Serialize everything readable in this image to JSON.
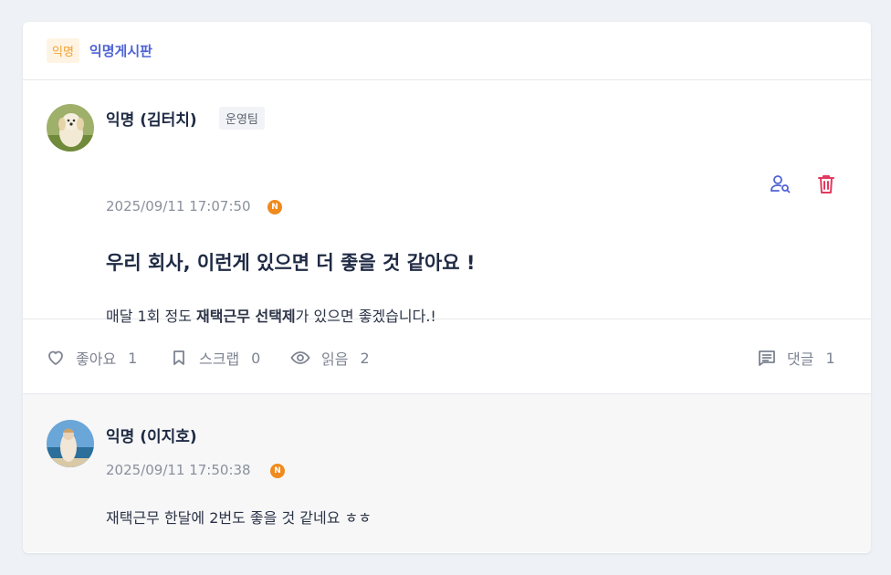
{
  "header": {
    "anon_badge": "익명",
    "board_name": "익명게시판"
  },
  "post": {
    "author": "익명 (김터치)",
    "team": "운영팀",
    "timestamp": "2025/09/11 17:07:50",
    "new_badge": "N",
    "title": "우리 회사, 이런게 있으면 더 좋을 것 같아요 !",
    "body_prefix": "매달 1회 정도 ",
    "body_bold": "재택근무 선택제",
    "body_suffix": "가 있으면 좋겠습니다.!"
  },
  "stats": {
    "like_label": "좋아요",
    "like_count": "1",
    "scrap_label": "스크랩",
    "scrap_count": "0",
    "read_label": "읽음",
    "read_count": "2",
    "comment_label": "댓글",
    "comment_count": "1"
  },
  "comment": {
    "author": "익명 (이지호)",
    "timestamp": "2025/09/11 17:50:38",
    "new_badge": "N",
    "body": "재택근무 한달에 2번도 좋을 것 같네요 ㅎㅎ"
  },
  "colors": {
    "accent": "#4f63d6",
    "delete": "#e23a5e",
    "new_badge": "#f08a1c"
  }
}
